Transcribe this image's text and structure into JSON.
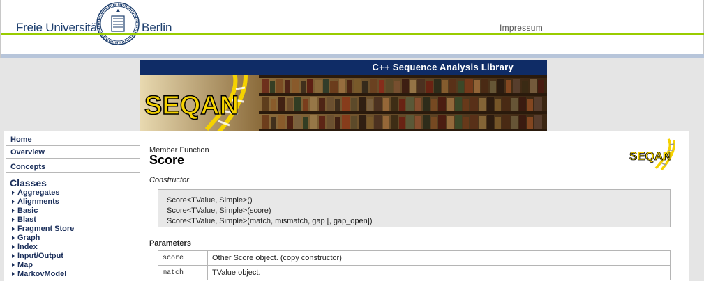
{
  "header": {
    "university_name": "Freie Universität",
    "university_city": "Berlin",
    "impressum_label": "Impressum"
  },
  "banner": {
    "title": "C++ Sequence Analysis Library",
    "logo_text": "SEQAN"
  },
  "nav": {
    "top_items": [
      {
        "label": "Home"
      },
      {
        "label": "Overview"
      },
      {
        "label": "Concepts"
      }
    ],
    "classes_heading": "Classes",
    "class_items": [
      {
        "label": "Aggregates"
      },
      {
        "label": "Alignments"
      },
      {
        "label": "Basic"
      },
      {
        "label": "Blast"
      },
      {
        "label": "Fragment Store"
      },
      {
        "label": "Graph"
      },
      {
        "label": "Index"
      },
      {
        "label": "Input/Output"
      },
      {
        "label": "Map"
      },
      {
        "label": "MarkovModel"
      }
    ]
  },
  "content": {
    "kind": "Member Function",
    "title": "Score",
    "logo_text": "SEQAN",
    "constructor_heading": "Constructor",
    "code_lines": [
      "Score<TValue, Simple>()",
      "Score<TValue, Simple>(score)",
      "Score<TValue, Simple>(match, mismatch, gap [, gap_open])"
    ],
    "parameters_heading": "Parameters",
    "parameters": [
      {
        "name": "score",
        "description": "Other Score object. (copy constructor)"
      },
      {
        "name": "match",
        "description": "TValue object."
      }
    ]
  },
  "colors": {
    "fu_blue": "#1e3f6e",
    "fu_green": "#99cc00",
    "banner_navy": "#0f2c66",
    "seqan_yellow": "#f5d200",
    "nav_text": "#1a2e5a"
  }
}
